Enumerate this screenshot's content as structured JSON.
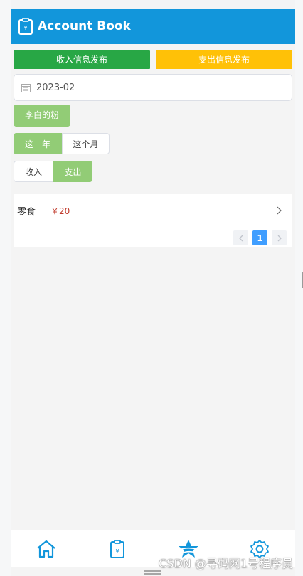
{
  "header": {
    "title": "Account Book",
    "icon": "clipboard-yen-icon"
  },
  "publish": {
    "income_label": "收入信息发布",
    "expense_label": "支出信息发布",
    "income_color": "#28a745",
    "expense_color": "#ffc107"
  },
  "filter": {
    "date_value": "2023-02",
    "calendar_icon": "calendar-icon",
    "user_tag": "李白的粉"
  },
  "period_toggle": {
    "year": "这一年",
    "month": "这个月",
    "selected": "这一年"
  },
  "type_toggle": {
    "income": "收入",
    "expense": "支出",
    "selected": "支出"
  },
  "records": [
    {
      "category": "零食",
      "amount": "￥20"
    }
  ],
  "pagination": {
    "current_page": "1"
  },
  "tabbar": {
    "items": [
      "home-icon",
      "clipboard-icon",
      "star-icon",
      "settings-icon"
    ],
    "color": "#1296db"
  },
  "watermark": "CSDN @寻码网1号程序员",
  "colors": {
    "brand": "#1296db",
    "active_green": "#92cc76",
    "amount_red": "#c0392b",
    "page_blue": "#409eff"
  }
}
